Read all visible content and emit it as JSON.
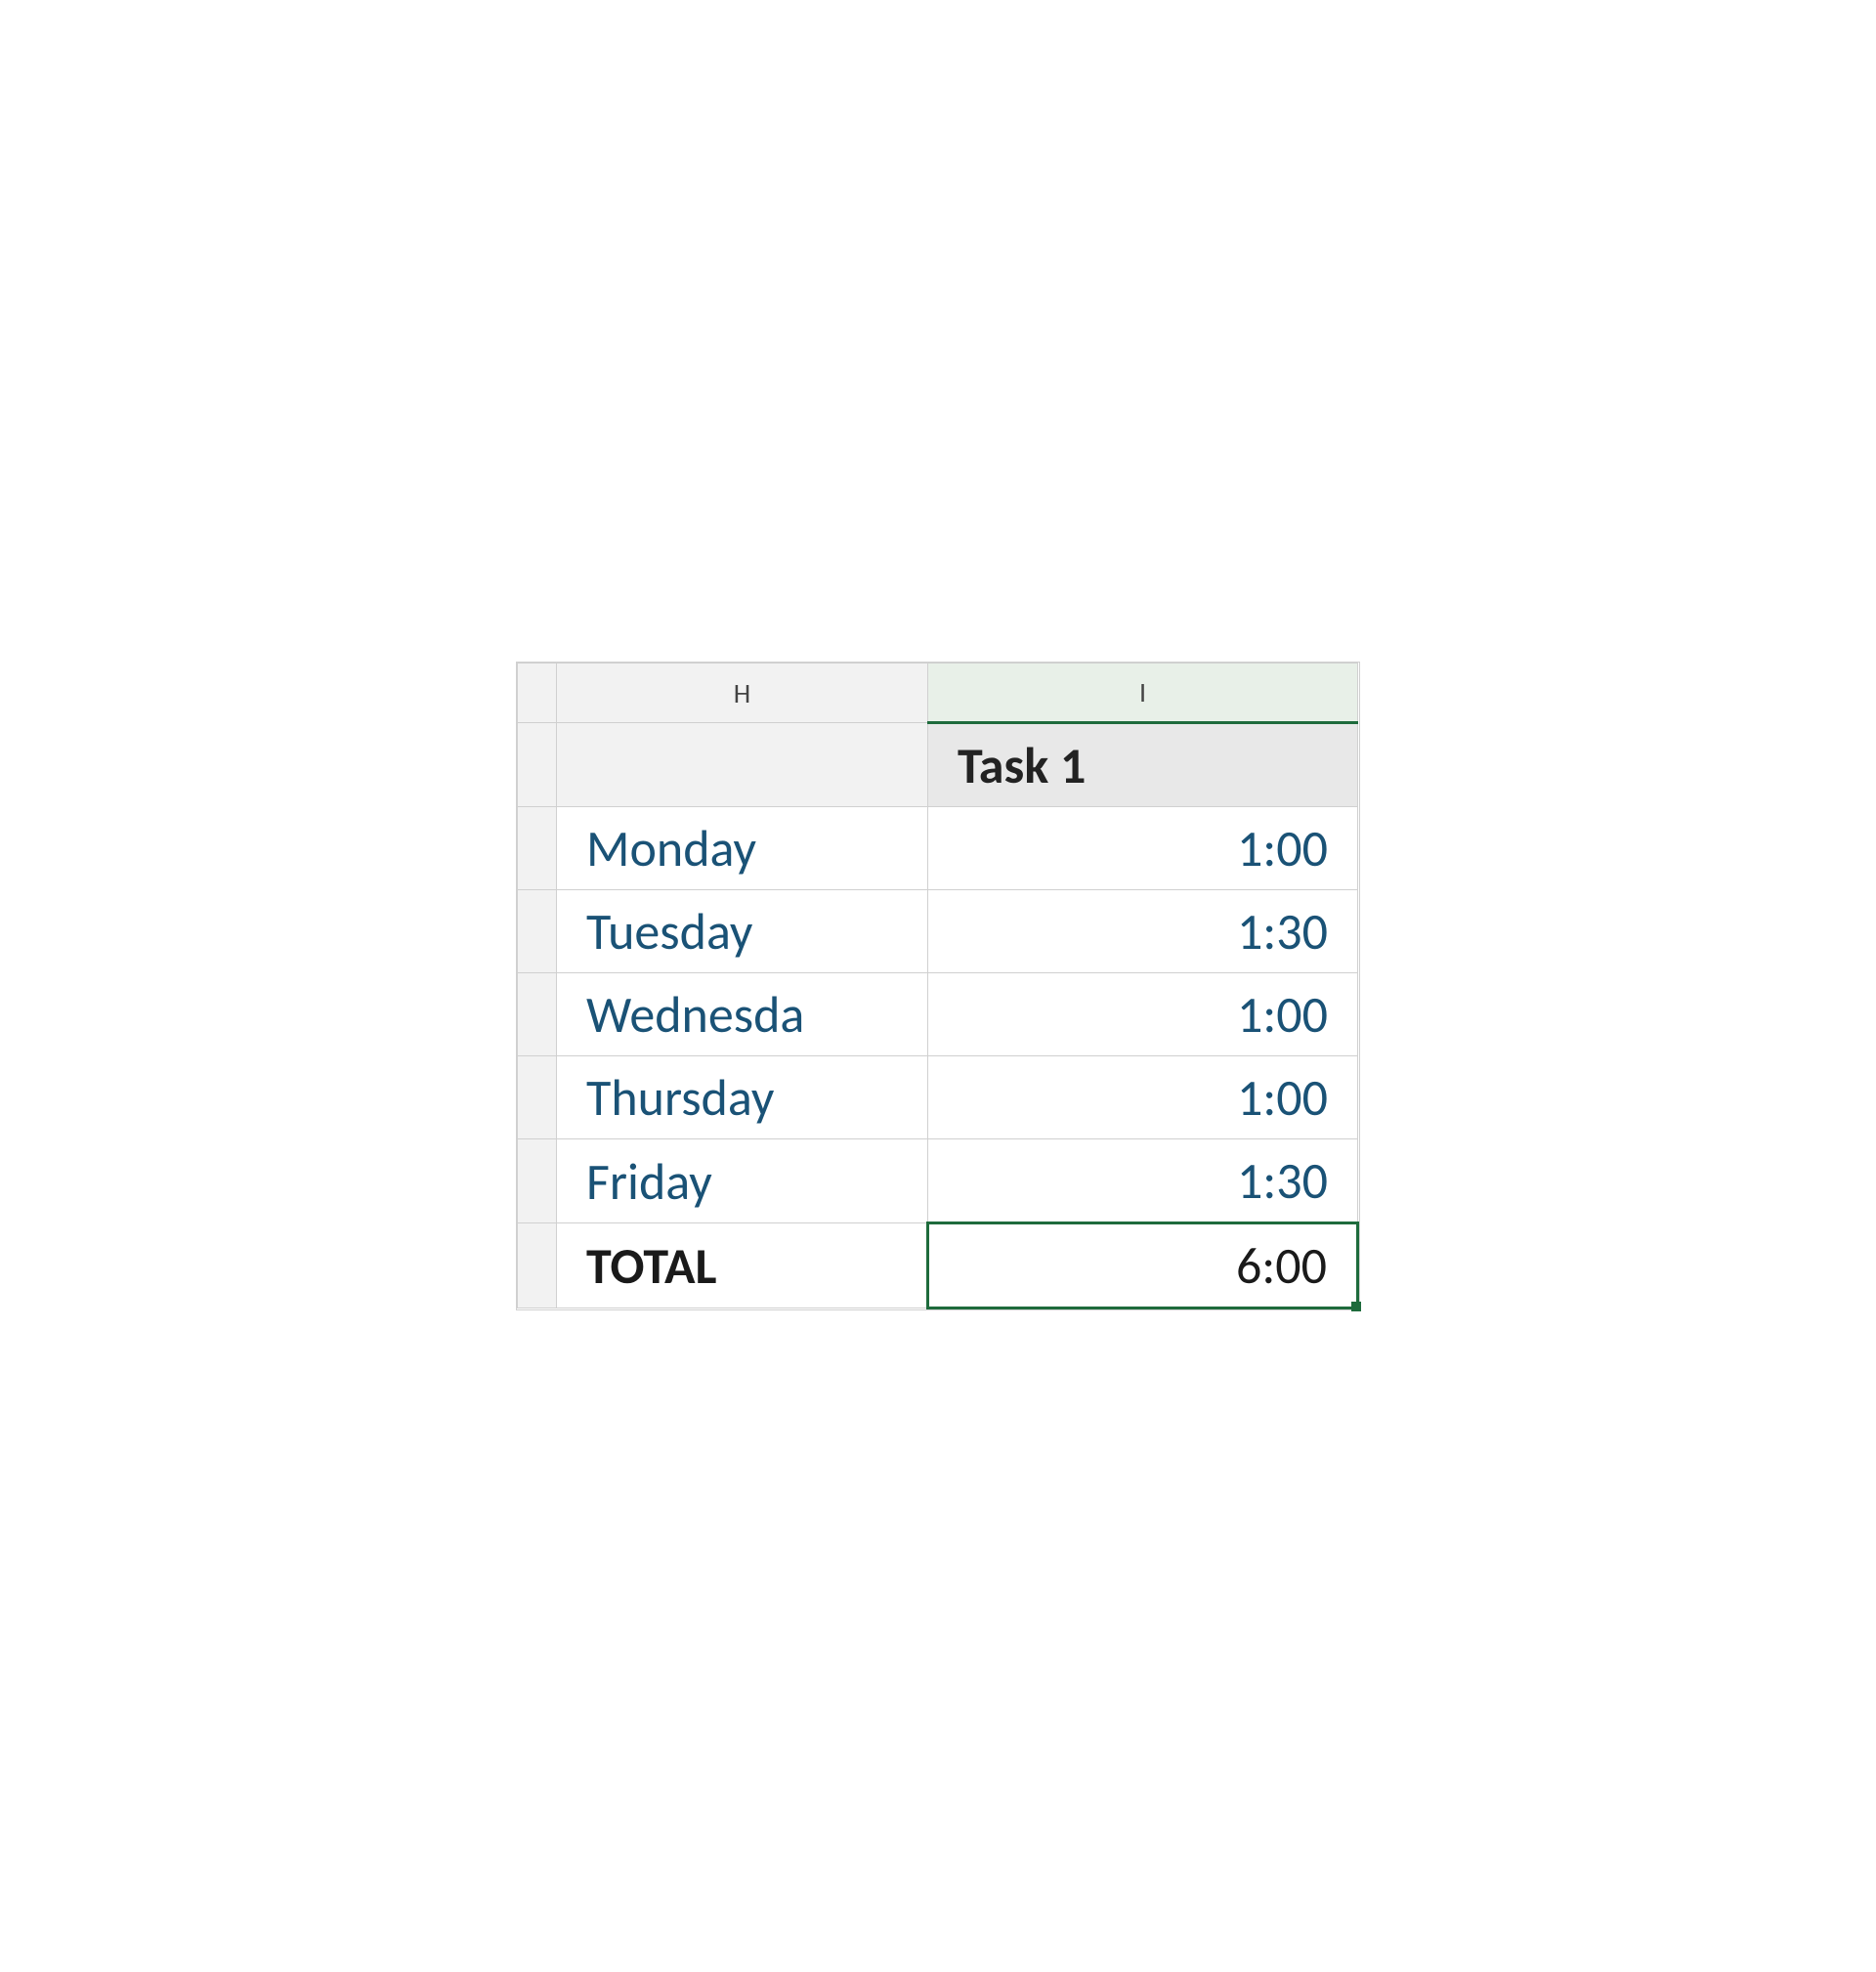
{
  "columns": {
    "h": {
      "label": "H"
    },
    "i": {
      "label": "I"
    }
  },
  "header_row": {
    "day_cell": "",
    "task_label": "Task 1"
  },
  "rows": [
    {
      "day": "Monday",
      "time": "1:00"
    },
    {
      "day": "Tuesday",
      "time": "1:30"
    },
    {
      "day": "Wednesda",
      "time": "1:00"
    },
    {
      "day": "Thursday",
      "time": "1:00"
    },
    {
      "day": "Friday",
      "time": "1:30"
    }
  ],
  "total_row": {
    "label": "TOTAL",
    "value": "6:00"
  }
}
